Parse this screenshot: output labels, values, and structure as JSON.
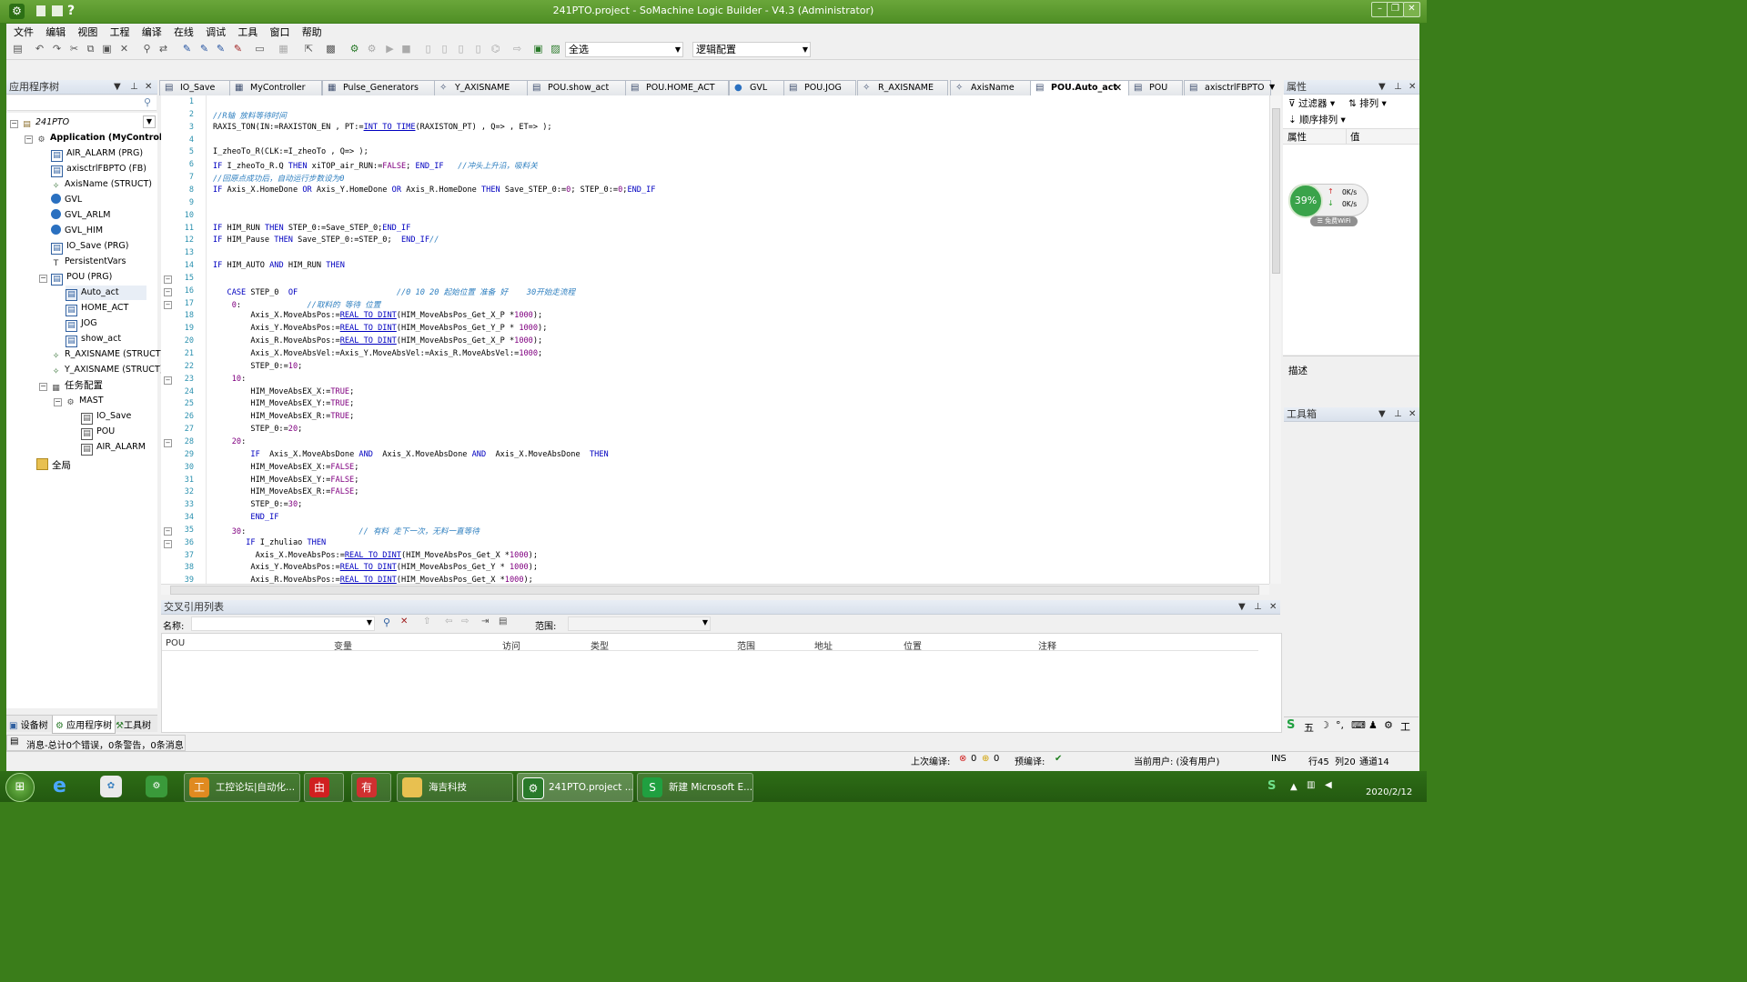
{
  "window": {
    "title": "241PTO.project - SoMachine Logic Builder - V4.3 (Administrator)",
    "colors": {
      "frame": "#4f8f25",
      "keyword": "#0000c0",
      "comment": "#3080c0",
      "number": "#800080",
      "accent_green": "#3aa34a"
    }
  },
  "menu": [
    "文件",
    "编辑",
    "视图",
    "工程",
    "编译",
    "在线",
    "调试",
    "工具",
    "窗口",
    "帮助"
  ],
  "toolbar": {
    "selection_combo": "全选",
    "config_combo": "逻辑配置",
    "icons": [
      "print-icon",
      "undo-icon",
      "redo-icon",
      "cut-icon",
      "copy-icon",
      "paste-icon",
      "delete-icon",
      "find-icon",
      "replace-icon",
      "build-icon",
      "login-icon",
      "logout-icon",
      "run-icon",
      "stop-icon",
      "reset-icon",
      "window-icon",
      "lock-icon"
    ]
  },
  "app_tree": {
    "header": "应用程序树",
    "items": [
      {
        "label": "241PTO",
        "icon": "project-icon"
      },
      {
        "label": "Application (MyController)",
        "icon": "gear-icon"
      },
      {
        "label": "AIR_ALARM (PRG)",
        "icon": "pou-icon"
      },
      {
        "label": "axisctrlFBPTO (FB)",
        "icon": "pou-icon"
      },
      {
        "label": "AxisName (STRUCT)",
        "icon": "struct-icon"
      },
      {
        "label": "GVL",
        "icon": "globe-icon"
      },
      {
        "label": "GVL_ARLM",
        "icon": "globe-icon"
      },
      {
        "label": "GVL_HIM",
        "icon": "globe-icon"
      },
      {
        "label": "IO_Save (PRG)",
        "icon": "pou-icon"
      },
      {
        "label": "PersistentVars",
        "icon": "persistent-icon"
      },
      {
        "label": "POU (PRG)",
        "icon": "pou-icon"
      },
      {
        "label": "Auto_act",
        "icon": "action-icon"
      },
      {
        "label": "HOME_ACT",
        "icon": "action-icon"
      },
      {
        "label": "JOG",
        "icon": "action-icon"
      },
      {
        "label": "show_act",
        "icon": "action-icon"
      },
      {
        "label": "R_AXISNAME (STRUCT)",
        "icon": "struct-icon"
      },
      {
        "label": "Y_AXISNAME (STRUCT)",
        "icon": "struct-icon"
      },
      {
        "label": "任务配置",
        "icon": "task-config-icon"
      },
      {
        "label": "MAST",
        "icon": "task-icon"
      },
      {
        "label": "IO_Save",
        "icon": "task-call-icon"
      },
      {
        "label": "POU",
        "icon": "task-call-icon"
      },
      {
        "label": "AIR_ALARM",
        "icon": "task-call-icon"
      },
      {
        "label": "全局",
        "icon": "folder-icon"
      }
    ],
    "bottom_tabs": [
      "设备树",
      "应用程序树",
      "工具树"
    ]
  },
  "editor_tabs": [
    "IO_Save",
    "MyController",
    "Pulse_Generators",
    "Y_AXISNAME",
    "POU.show_act",
    "POU.HOME_ACT",
    "GVL",
    "POU.JOG",
    "R_AXISNAME",
    "AxisName",
    "POU.Auto_act",
    "POU",
    "axisctrlFBPTO"
  ],
  "code": {
    "lines": [
      "",
      "//R轴 放料等待时间",
      "RAXIS_TON(IN:=RAXISTON_EN , PT:=INT_TO_TIME(RAXISTON_PT) , Q=> , ET=> );",
      "",
      "I_zheoTo_R(CLK:=I_zheoTo , Q=> );",
      "IF I_zheoTo_R.Q THEN xiTOP_air_RUN:=FALSE; END_IF   //冲头上升沿，吸料关",
      "//回原点成功后，自动运行步数设为0",
      "IF Axis_X.HomeDone OR Axis_Y.HomeDone OR Axis_R.HomeDone THEN Save_STEP_0:=0; STEP_0:=0;END_IF",
      "",
      "",
      "IF HIM_RUN THEN STEP_0:=Save_STEP_0;END_IF",
      "IF HIM_Pause THEN Save_STEP_0:=STEP_0;  END_IF//",
      "",
      "IF HIM_AUTO AND HIM_RUN THEN",
      "",
      "   CASE STEP_0  OF                     //0 10 20 起始位置 准备 好    30开始走流程",
      "    0:              //取料的 等待 位置",
      "        Axis_X.MoveAbsPos:=REAL_TO_DINT(HIM_MoveAbsPos_Get_X_P *1000);",
      "        Axis_Y.MoveAbsPos:=REAL_TO_DINT(HIM_MoveAbsPos_Get_Y_P * 1000);",
      "        Axis_R.MoveAbsPos:=REAL_TO_DINT(HIM_MoveAbsPos_Get_X_P *1000);",
      "        Axis_X.MoveAbsVel:=Axis_Y.MoveAbsVel:=Axis_R.MoveAbsVel:=1000;",
      "        STEP_0:=10;",
      "    10:",
      "        HIM_MoveAbsEX_X:=TRUE;",
      "        HIM_MoveAbsEX_Y:=TRUE;",
      "        HIM_MoveAbsEX_R:=TRUE;",
      "        STEP_0:=20;",
      "    20:",
      "        IF  Axis_X.MoveAbsDone AND  Axis_X.MoveAbsDone AND  Axis_X.MoveAbsDone  THEN",
      "        HIM_MoveAbsEX_X:=FALSE;",
      "        HIM_MoveAbsEX_Y:=FALSE;",
      "        HIM_MoveAbsEX_R:=FALSE;",
      "        STEP_0:=30;",
      "        END_IF",
      "    30:                        // 有料 走下一次，无料一直等待",
      "       IF I_zhuliao THEN",
      "         Axis_X.MoveAbsPos:=REAL_TO_DINT(HIM_MoveAbsPos_Get_X *1000);",
      "        Axis_Y.MoveAbsPos:=REAL_TO_DINT(HIM_MoveAbsPos_Get_Y * 1000);",
      "        Axis_R.MoveAbsPos:=REAL_TO_DINT(HIM_MoveAbsPos_Get_X *1000);"
    ]
  },
  "xref": {
    "header": "交叉引用列表",
    "name_label": "名称:",
    "scope_label": "范围:",
    "columns": [
      "POU",
      "变量",
      "访问",
      "类型",
      "范围",
      "地址",
      "位置",
      "注释"
    ]
  },
  "properties": {
    "header": "属性",
    "filter": "过滤器",
    "sort": "排列",
    "order": "顺序排列",
    "col_prop": "属性",
    "col_value": "值",
    "desc": "描述"
  },
  "net_widget": {
    "percent": "39%",
    "up": "0K/s",
    "down": "0K/s",
    "wifi": "免费WiFi"
  },
  "toolbox": {
    "header": "工具箱"
  },
  "status": {
    "messages": "消息-总计0个错误，0条警告，0条消息",
    "last_build": "上次编译:",
    "err_count": "0",
    "warn_count": "0",
    "precompile": "预编译:",
    "user": "当前用户: (没有用户)",
    "ins": "INS",
    "row": "行45",
    "col": "列20",
    "ch": "通道14"
  },
  "taskbar": {
    "items": [
      "工控论坛|自动化...",
      "",
      "",
      "海吉科技",
      "241PTO.project ...",
      "新建 Microsoft E..."
    ],
    "date": "2020/2/12"
  }
}
